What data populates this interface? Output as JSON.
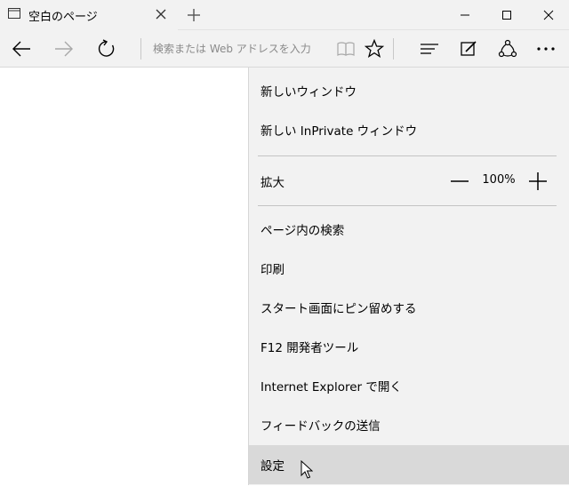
{
  "window": {
    "tab": {
      "title": "空白のページ"
    },
    "controls": [
      "minimize",
      "maximize",
      "close"
    ]
  },
  "navbar": {
    "address_placeholder": "検索または Web アドレスを入力"
  },
  "menu": {
    "items_top": [
      {
        "label": "新しいウィンドウ"
      },
      {
        "label": "新しい InPrivate ウィンドウ"
      }
    ],
    "zoom": {
      "label": "拡大",
      "value": "100%"
    },
    "items_bottom": [
      {
        "label": "ページ内の検索"
      },
      {
        "label": "印刷"
      },
      {
        "label": "スタート画面にピン留めする"
      },
      {
        "label": "F12 開発者ツール"
      },
      {
        "label": "Internet Explorer で開く"
      },
      {
        "label": "フィードバックの送信"
      },
      {
        "label": "設定",
        "highlighted": true
      }
    ]
  },
  "colors": {
    "chrome_bg": "#f2f2f2",
    "menu_bg": "#f2f2f2",
    "hover_bg": "#d9d9d9",
    "separator": "#c4c4c4",
    "placeholder_text": "#8a8a8a"
  }
}
